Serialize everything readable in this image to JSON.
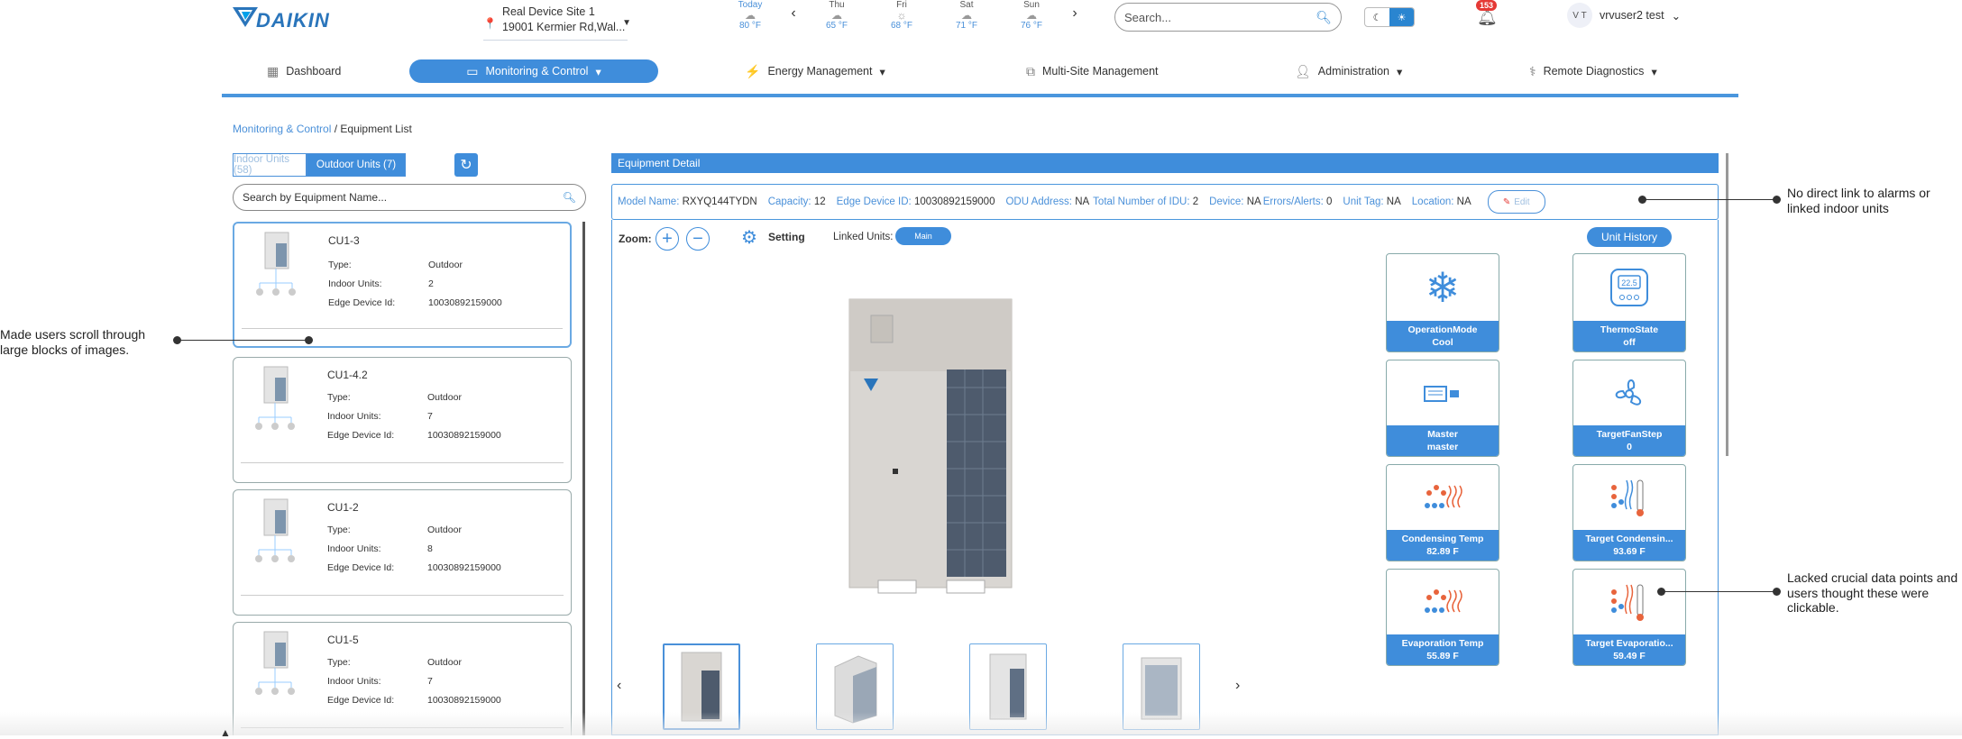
{
  "brand": {
    "name": "DAIKIN",
    "color": "#2a75bb"
  },
  "site": {
    "line1": "Real Device Site 1",
    "line2": "19001 Kermier Rd,Wal..."
  },
  "weather": {
    "days": [
      {
        "day": "Today",
        "temp": "80 °F",
        "icon": "cloud-icon"
      },
      {
        "day": "Thu",
        "temp": "65 °F",
        "icon": "cloud-icon"
      },
      {
        "day": "Fri",
        "temp": "68 °F",
        "icon": "sun-icon"
      },
      {
        "day": "Sat",
        "temp": "71 °F",
        "icon": "cloud-icon"
      },
      {
        "day": "Sun",
        "temp": "76 °F",
        "icon": "cloud-icon"
      }
    ]
  },
  "search": {
    "placeholder": "Search..."
  },
  "notifications": {
    "count": "153"
  },
  "user": {
    "initials": "V T",
    "name": "vrvuser2 test"
  },
  "nav": {
    "dashboard": "Dashboard",
    "monitoring": "Monitoring & Control",
    "energy": "Energy Management",
    "multisite": "Multi-Site Management",
    "admin": "Administration",
    "diagnostics": "Remote Diagnostics"
  },
  "breadcrumb": {
    "parent": "Monitoring & Control",
    "sep": " / ",
    "current": "Equipment List"
  },
  "unit_tabs": {
    "indoor": "Indoor Units (58)",
    "outdoor": "Outdoor Units (7)"
  },
  "equipment_search": {
    "placeholder": "Search by Equipment Name..."
  },
  "labels": {
    "type": "Type:",
    "indoor_units": "Indoor Units:",
    "edge_device": "Edge Device Id:"
  },
  "equipment": [
    {
      "name": "CU1-3",
      "type": "Outdoor",
      "indoor_units": "2",
      "edge_device_id": "10030892159000"
    },
    {
      "name": "CU1-4.2",
      "type": "Outdoor",
      "indoor_units": "7",
      "edge_device_id": "10030892159000"
    },
    {
      "name": "CU1-2",
      "type": "Outdoor",
      "indoor_units": "8",
      "edge_device_id": "10030892159000"
    },
    {
      "name": "CU1-5",
      "type": "Outdoor",
      "indoor_units": "7",
      "edge_device_id": "10030892159000"
    }
  ],
  "detail": {
    "title": "Equipment Detail",
    "info": {
      "model_key": "Model Name:",
      "model": "RXYQ144TYDN",
      "capacity_key": "Capacity:",
      "capacity": "12",
      "edge_key": "Edge Device ID:",
      "edge": "10030892159000",
      "odu_key": "ODU Address:",
      "odu": "NA",
      "idu_key": "Total Number of IDU:",
      "idu": "2",
      "device_key": "Device:",
      "device": "NA",
      "errors_key": "Errors/Alerts:",
      "errors": "0",
      "tag_key": "Unit Tag:",
      "tag": "NA",
      "location_key": "Location:",
      "location": "NA",
      "edit": "Edit"
    },
    "zoom": "Zoom:",
    "setting": "Setting",
    "linked_units": "Linked Units:",
    "main_chip": "Main",
    "unit_history": "Unit History",
    "tiles": [
      {
        "label": "OperationMode",
        "value": "Cool",
        "icon": "snowflake-icon"
      },
      {
        "label": "ThermoState",
        "value": "off",
        "icon": "thermostat-icon"
      },
      {
        "label": "Master",
        "value": "master",
        "icon": "controller-icon"
      },
      {
        "label": "TargetFanStep",
        "value": "0",
        "icon": "fan-icon"
      },
      {
        "label": "Condensing Temp",
        "value": "82.89 F",
        "icon": "condensing-icon"
      },
      {
        "label": "Target Condensin...",
        "value": "93.69 F",
        "icon": "target-temp-icon"
      },
      {
        "label": "Evaporation Temp",
        "value": "55.89 F",
        "icon": "evaporation-icon"
      },
      {
        "label": "Target Evaporatio...",
        "value": "59.49 F",
        "icon": "target-temp-icon"
      }
    ]
  },
  "annotations": {
    "top_right": "No direct link to alarms or linked indoor units",
    "left": "Made users scroll through large blocks of images.",
    "bottom_right": "Lacked crucial data points and users thought these were clickable."
  }
}
